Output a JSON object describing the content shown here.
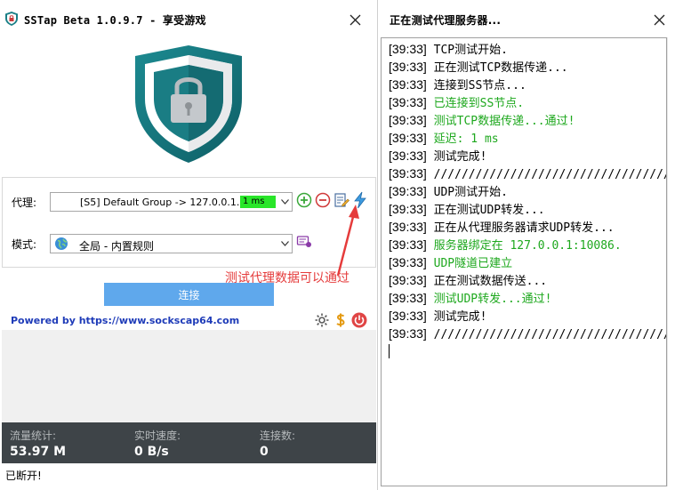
{
  "left_window": {
    "title": "SSTap Beta 1.0.9.7 - 享受游戏",
    "proxy": {
      "label": "代理:",
      "selected": "[S5] Default Group -> 127.0.0.1...",
      "latency": "1 ms"
    },
    "mode": {
      "label": "模式:",
      "selected": "全局 - 内置规则"
    },
    "annotation": "测试代理数据可以通过",
    "connect_label": "连接",
    "powered_by": "Powered by https://www.sockscap64.com",
    "stats": [
      {
        "label": "流量统计:",
        "value": "53.97 M"
      },
      {
        "label": "实时速度:",
        "value": "0 B/s"
      },
      {
        "label": "连接数:",
        "value": "0"
      }
    ],
    "status": "已断开!"
  },
  "right_window": {
    "title": "正在测试代理服务器...",
    "log": [
      {
        "ts": "[39:33]",
        "msg": "TCP测试开始.",
        "color": "black"
      },
      {
        "ts": "[39:33]",
        "msg": "正在测试TCP数据传递...",
        "color": "black"
      },
      {
        "ts": "[39:33]",
        "msg": "连接到SS节点...",
        "color": "black"
      },
      {
        "ts": "[39:33]",
        "msg": "已连接到SS节点.",
        "color": "green"
      },
      {
        "ts": "[39:33]",
        "msg": "测试TCP数据传递...通过!",
        "color": "green"
      },
      {
        "ts": "[39:33]",
        "msg": "延迟: 1 ms",
        "color": "green"
      },
      {
        "ts": "[39:33]",
        "msg": "测试完成!",
        "color": "black"
      },
      {
        "ts": "[39:33]",
        "msg": "////////////////////////////////////////////",
        "color": "black"
      },
      {
        "ts": "[39:33]",
        "msg": "UDP测试开始.",
        "color": "black"
      },
      {
        "ts": "[39:33]",
        "msg": "正在测试UDP转发...",
        "color": "black"
      },
      {
        "ts": "[39:33]",
        "msg": "正在从代理服务器请求UDP转发...",
        "color": "black"
      },
      {
        "ts": "[39:33]",
        "msg": "服务器绑定在 127.0.0.1:10086.",
        "color": "green"
      },
      {
        "ts": "[39:33]",
        "msg": "UDP隧道已建立",
        "color": "green"
      },
      {
        "ts": "[39:33]",
        "msg": "正在测试数据传送...",
        "color": "black"
      },
      {
        "ts": "[39:33]",
        "msg": "测试UDP转发...通过!",
        "color": "green"
      },
      {
        "ts": "[39:33]",
        "msg": "测试完成!",
        "color": "black"
      },
      {
        "ts": "[39:33]",
        "msg": "////////////////////////////////////////////",
        "color": "black"
      }
    ]
  },
  "colors": {
    "accent": "#5fa8ec",
    "latency_bg": "#29e629",
    "success_text": "#1ea81e",
    "annotation": "#e53b3b",
    "stats_bg": "#3e4448",
    "shield_teal": "#177a80"
  },
  "icons": {
    "app": "shield-icon",
    "close": "close-icon",
    "add": "plus-circle-icon",
    "remove": "minus-circle-icon",
    "edit": "edit-note-icon",
    "test": "lightning-icon",
    "mode_globe": "globe-icon",
    "mode_edit": "mode-edit-icon",
    "settings": "gear-icon",
    "donate": "dollar-icon",
    "power": "power-icon"
  }
}
